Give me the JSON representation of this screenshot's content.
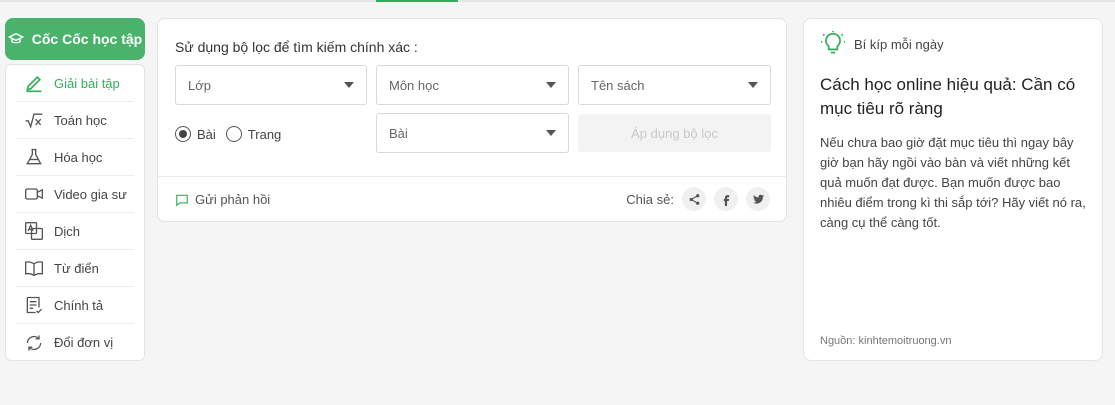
{
  "brand": {
    "label": "Cốc Cốc học tập",
    "icon": "graduation-cap-icon",
    "color": "#4ab26b"
  },
  "sidebar": {
    "items": [
      {
        "label": "Giải bài tập",
        "icon": "pencil-icon",
        "active": true
      },
      {
        "label": "Toán học",
        "icon": "sqrt-x-icon"
      },
      {
        "label": "Hóa học",
        "icon": "flask-icon"
      },
      {
        "label": "Video gia sư",
        "icon": "video-camera-icon"
      },
      {
        "label": "Dịch",
        "icon": "translate-icon"
      },
      {
        "label": "Từ điển",
        "icon": "open-book-icon"
      },
      {
        "label": "Chính tả",
        "icon": "document-check-icon"
      },
      {
        "label": "Đổi đơn vị",
        "icon": "convert-arrows-icon"
      }
    ]
  },
  "filter": {
    "title": "Sử dụng bộ lọc để tìm kiếm chính xác :",
    "selects": {
      "grade": "Lớp",
      "subject": "Môn học",
      "book": "Tên sách",
      "lesson": "Bài"
    },
    "radio": {
      "option1": "Bài",
      "option2": "Trang",
      "selected": "Bài"
    },
    "apply_label": "Áp dụng bộ lọc",
    "feedback_label": "Gửi phản hồi",
    "share_label": "Chia sẻ:"
  },
  "tip": {
    "header": "Bí kíp mỗi ngày",
    "title": "Cách học online hiệu quả: Cần có mục tiêu rõ ràng",
    "body": "Nếu chưa bao giờ đặt mục tiêu thì ngay bây giờ bạn hãy ngồi vào bàn và viết những kết quả muốn đạt được. Bạn muốn được bao nhiêu điểm trong kì thi sắp tới? Hãy viết nó ra, càng cụ thể càng tốt.",
    "source": "Nguồn: kinhtemoitruong.vn"
  },
  "colors": {
    "accent": "#2eb15a",
    "brand": "#4ab26b"
  }
}
